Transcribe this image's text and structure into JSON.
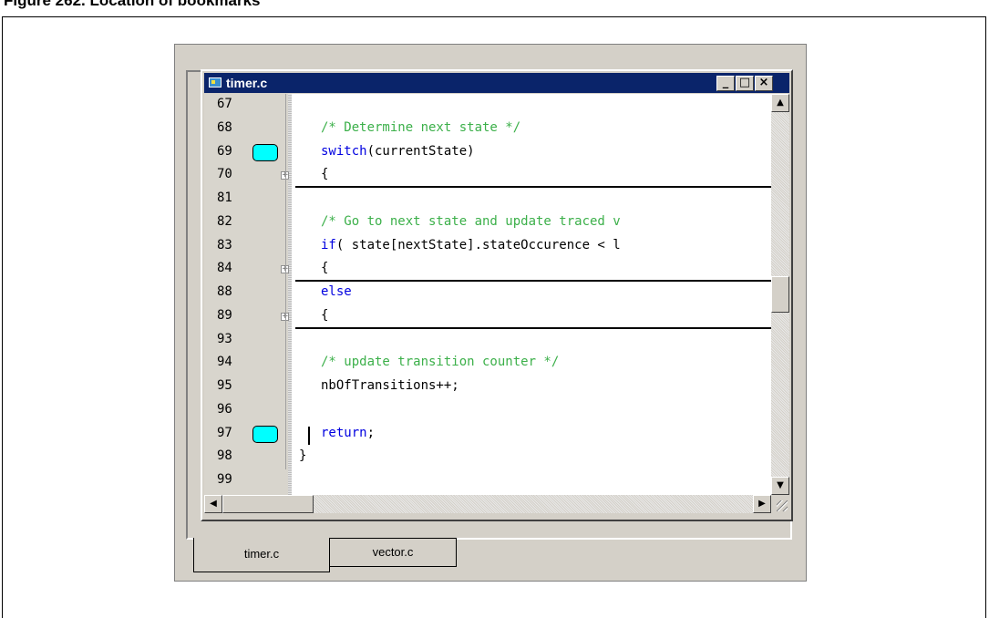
{
  "figure": {
    "caption": "Figure 262. Location of bookmarks"
  },
  "window": {
    "title": "timer.c",
    "buttons": {
      "minimize": "_",
      "maximize": "□",
      "close": "×"
    }
  },
  "editor": {
    "lines": [
      {
        "number": "67",
        "bookmark": false,
        "fold": false,
        "text": "",
        "style": "normal"
      },
      {
        "number": "68",
        "bookmark": false,
        "fold": false,
        "text": "/* Determine next state */",
        "style": "comment"
      },
      {
        "number": "69",
        "bookmark": true,
        "fold": false,
        "keyword": "switch",
        "text": "(currentState)",
        "style": "mixed"
      },
      {
        "number": "70",
        "bookmark": false,
        "fold": true,
        "text": "{",
        "style": "normal",
        "collapsed": true
      },
      {
        "number": "81",
        "bookmark": false,
        "fold": false,
        "text": "",
        "style": "normal"
      },
      {
        "number": "82",
        "bookmark": false,
        "fold": false,
        "text": "/* Go to next state and update traced v",
        "style": "comment"
      },
      {
        "number": "83",
        "bookmark": false,
        "fold": false,
        "keyword": "if",
        "text": "( state[nextState].stateOccurence < l",
        "style": "mixed"
      },
      {
        "number": "84",
        "bookmark": false,
        "fold": true,
        "text": "{",
        "style": "normal",
        "collapsed": true
      },
      {
        "number": "88",
        "bookmark": false,
        "fold": false,
        "keyword": "else",
        "text": "",
        "style": "mixed"
      },
      {
        "number": "89",
        "bookmark": false,
        "fold": true,
        "text": "{",
        "style": "normal",
        "collapsed": true
      },
      {
        "number": "93",
        "bookmark": false,
        "fold": false,
        "text": "",
        "style": "normal"
      },
      {
        "number": "94",
        "bookmark": false,
        "fold": false,
        "text": "/* update transition counter */",
        "style": "comment"
      },
      {
        "number": "95",
        "bookmark": false,
        "fold": false,
        "text": "nbOfTransitions++;",
        "style": "normal"
      },
      {
        "number": "96",
        "bookmark": false,
        "fold": false,
        "text": "",
        "style": "normal"
      },
      {
        "number": "97",
        "bookmark": true,
        "fold": false,
        "keyword": "return",
        "text": ";",
        "style": "mixed",
        "caret": true
      },
      {
        "number": "98",
        "bookmark": false,
        "fold": false,
        "text": "}",
        "style": "normal",
        "brace": true
      },
      {
        "number": "99",
        "bookmark": false,
        "fold": false,
        "text": "",
        "style": "normal"
      }
    ]
  },
  "scrollbars": {
    "vertical_position": 0.5,
    "up_arrow": "▲",
    "down_arrow": "▼",
    "left_arrow": "◀",
    "right_arrow": "▶"
  },
  "tabs": [
    {
      "label": "timer.c",
      "active": true
    },
    {
      "label": "vector.c",
      "active": false
    }
  ],
  "colors": {
    "titlebar": "#0a246a",
    "bookmark": "#00ffff",
    "keyword": "#0000e0",
    "comment": "#3cb04a"
  }
}
